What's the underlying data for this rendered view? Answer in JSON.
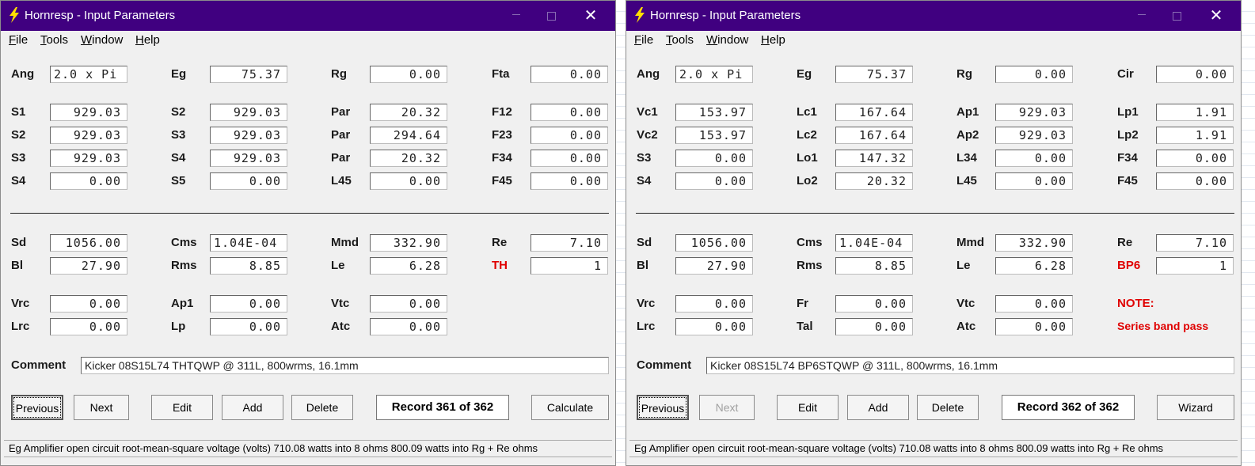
{
  "common": {
    "title": "Hornresp - Input Parameters",
    "menu": [
      "File",
      "Tools",
      "Window",
      "Help"
    ],
    "buttons": {
      "previous": "Previous",
      "edit": "Edit",
      "add": "Add",
      "delete": "Delete"
    },
    "comment_label": "Comment",
    "status": "Eg   Amplifier open circuit root-mean-square voltage  (volts)   710.08 watts into 8 ohms    800.09 watts into Rg + Re ohms",
    "close_glyph": "✕"
  },
  "left": {
    "top": [
      [
        [
          "Ang",
          "2.0 x Pi"
        ],
        [
          "Eg",
          "75.37"
        ],
        [
          "Rg",
          "0.00"
        ],
        [
          "Fta",
          "0.00"
        ]
      ]
    ],
    "grid1": [
      [
        [
          "S1",
          "929.03"
        ],
        [
          "S2",
          "929.03"
        ],
        [
          "Par",
          "20.32"
        ],
        [
          "F12",
          "0.00"
        ]
      ],
      [
        [
          "S2",
          "929.03"
        ],
        [
          "S3",
          "929.03"
        ],
        [
          "Par",
          "294.64"
        ],
        [
          "F23",
          "0.00"
        ]
      ],
      [
        [
          "S3",
          "929.03"
        ],
        [
          "S4",
          "929.03"
        ],
        [
          "Par",
          "20.32"
        ],
        [
          "F34",
          "0.00"
        ]
      ],
      [
        [
          "S4",
          "0.00"
        ],
        [
          "S5",
          "0.00"
        ],
        [
          "L45",
          "0.00"
        ],
        [
          "F45",
          "0.00"
        ]
      ]
    ],
    "grid2": [
      [
        [
          "Sd",
          "1056.00"
        ],
        [
          "Cms",
          "1.04E-04"
        ],
        [
          "Mmd",
          "332.90"
        ],
        [
          "Re",
          "7.10"
        ]
      ],
      [
        [
          "Bl",
          "27.90"
        ],
        [
          "Rms",
          "8.85"
        ],
        [
          "Le",
          "6.28"
        ],
        [
          "TH",
          "1"
        ]
      ]
    ],
    "grid3": [
      [
        [
          "Vrc",
          "0.00"
        ],
        [
          "Ap1",
          "0.00"
        ],
        [
          "Vtc",
          "0.00"
        ]
      ],
      [
        [
          "Lrc",
          "0.00"
        ],
        [
          "Lp",
          "0.00"
        ],
        [
          "Atc",
          "0.00"
        ]
      ]
    ],
    "comment": "Kicker 08S15L74 THTQWP @ 311L, 800wrms, 16.1mm",
    "next": "Next",
    "record": "Record 361 of 362",
    "action": "Calculate"
  },
  "right": {
    "top": [
      [
        [
          "Ang",
          "2.0 x Pi"
        ],
        [
          "Eg",
          "75.37"
        ],
        [
          "Rg",
          "0.00"
        ],
        [
          "Cir",
          "0.00"
        ]
      ]
    ],
    "grid1": [
      [
        [
          "Vc1",
          "153.97"
        ],
        [
          "Lc1",
          "167.64"
        ],
        [
          "Ap1",
          "929.03"
        ],
        [
          "Lp1",
          "1.91"
        ]
      ],
      [
        [
          "Vc2",
          "153.97"
        ],
        [
          "Lc2",
          "167.64"
        ],
        [
          "Ap2",
          "929.03"
        ],
        [
          "Lp2",
          "1.91"
        ]
      ],
      [
        [
          "S3",
          "0.00"
        ],
        [
          "Lo1",
          "147.32"
        ],
        [
          "L34",
          "0.00"
        ],
        [
          "F34",
          "0.00"
        ]
      ],
      [
        [
          "S4",
          "0.00"
        ],
        [
          "Lo2",
          "20.32"
        ],
        [
          "L45",
          "0.00"
        ],
        [
          "F45",
          "0.00"
        ]
      ]
    ],
    "grid2": [
      [
        [
          "Sd",
          "1056.00"
        ],
        [
          "Cms",
          "1.04E-04"
        ],
        [
          "Mmd",
          "332.90"
        ],
        [
          "Re",
          "7.10"
        ]
      ],
      [
        [
          "Bl",
          "27.90"
        ],
        [
          "Rms",
          "8.85"
        ],
        [
          "Le",
          "6.28"
        ],
        [
          "BP6",
          "1"
        ]
      ]
    ],
    "grid3": [
      [
        [
          "Vrc",
          "0.00"
        ],
        [
          "Fr",
          "0.00"
        ],
        [
          "Vtc",
          "0.00"
        ]
      ],
      [
        [
          "Lrc",
          "0.00"
        ],
        [
          "Tal",
          "0.00"
        ],
        [
          "Atc",
          "0.00"
        ]
      ]
    ],
    "note_label": "NOTE:",
    "note_text": "Series band pass",
    "comment": "Kicker 08S15L74 BP6STQWP @ 311L, 800wrms, 16.1mm",
    "next": "Next",
    "record": "Record 362 of 362",
    "action": "Wizard"
  },
  "colors": {
    "titlebar": "#400080",
    "highlight_label": "#e00000"
  }
}
